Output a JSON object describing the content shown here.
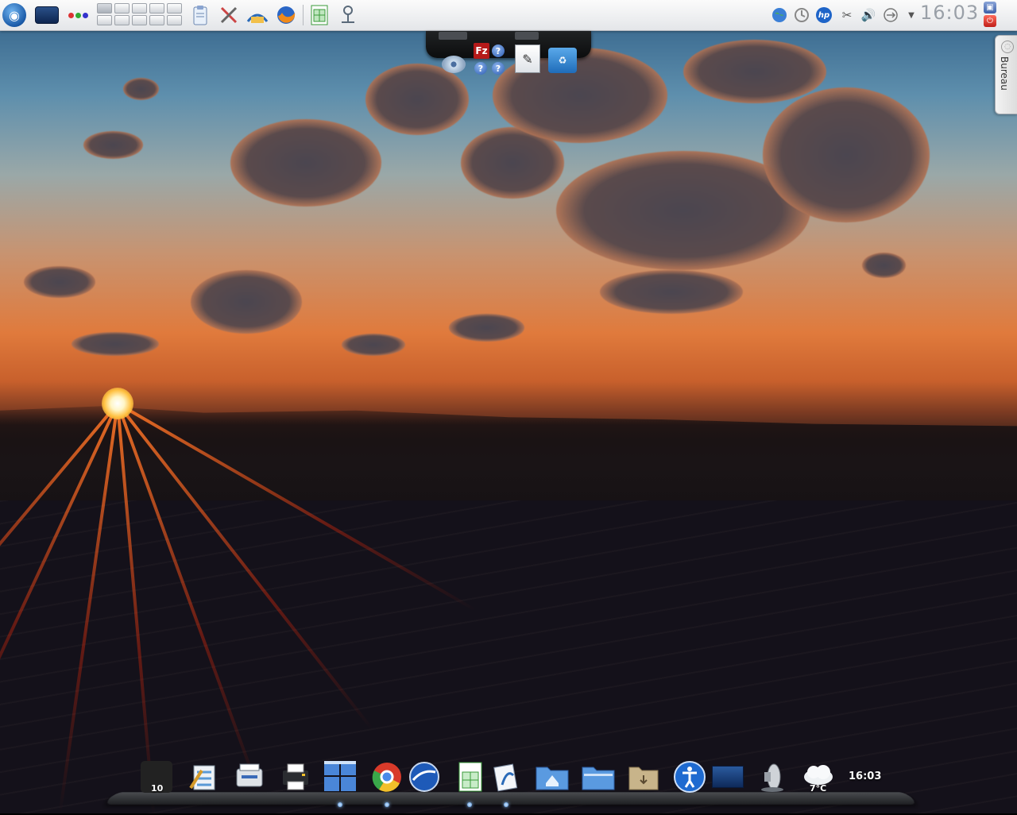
{
  "top_panel": {
    "clock": "16:03",
    "launchers": [
      {
        "name": "application-launcher",
        "icon": "kde-kicker-icon"
      },
      {
        "name": "show-desktop",
        "icon": "desktop-icon"
      },
      {
        "name": "activities",
        "icon": "activities-dots-icon"
      },
      {
        "name": "clipboard",
        "icon": "clipboard-icon"
      },
      {
        "name": "system-settings",
        "icon": "tools-icon"
      },
      {
        "name": "software-manager",
        "icon": "package-icon"
      },
      {
        "name": "firefox",
        "icon": "firefox-icon"
      },
      {
        "name": "spreadsheet",
        "icon": "spreadsheet-icon"
      },
      {
        "name": "network-tool",
        "icon": "network-icon"
      }
    ],
    "pager_workspaces": 10,
    "tray": [
      "globe-icon",
      "update-icon",
      "hp-printer-icon",
      "scissors-icon",
      "volume-icon",
      "usb-icon",
      "arrow-down-icon"
    ],
    "hp_label": "hp"
  },
  "mini_dock": {
    "filezilla_label": "Fz",
    "help_label": "?"
  },
  "side_tab": {
    "label": "Bureau"
  },
  "bottom_dock": {
    "workspace_count": "10",
    "weather_temp": "7°C",
    "clock": "16:03",
    "items": [
      "workspace-switcher",
      "text-editor",
      "scanner",
      "printer",
      "file-manager-windows",
      "chrome",
      "google-earth",
      "spreadsheet",
      "mail",
      "home-folder",
      "folder",
      "downloads-folder",
      "accessibility",
      "desktop",
      "speaker",
      "weather",
      "clock"
    ]
  },
  "colors": {
    "panel_bg": "#e8eaed",
    "dock_bg": "#2a2c30",
    "accent_blue": "#1a5aa8"
  }
}
